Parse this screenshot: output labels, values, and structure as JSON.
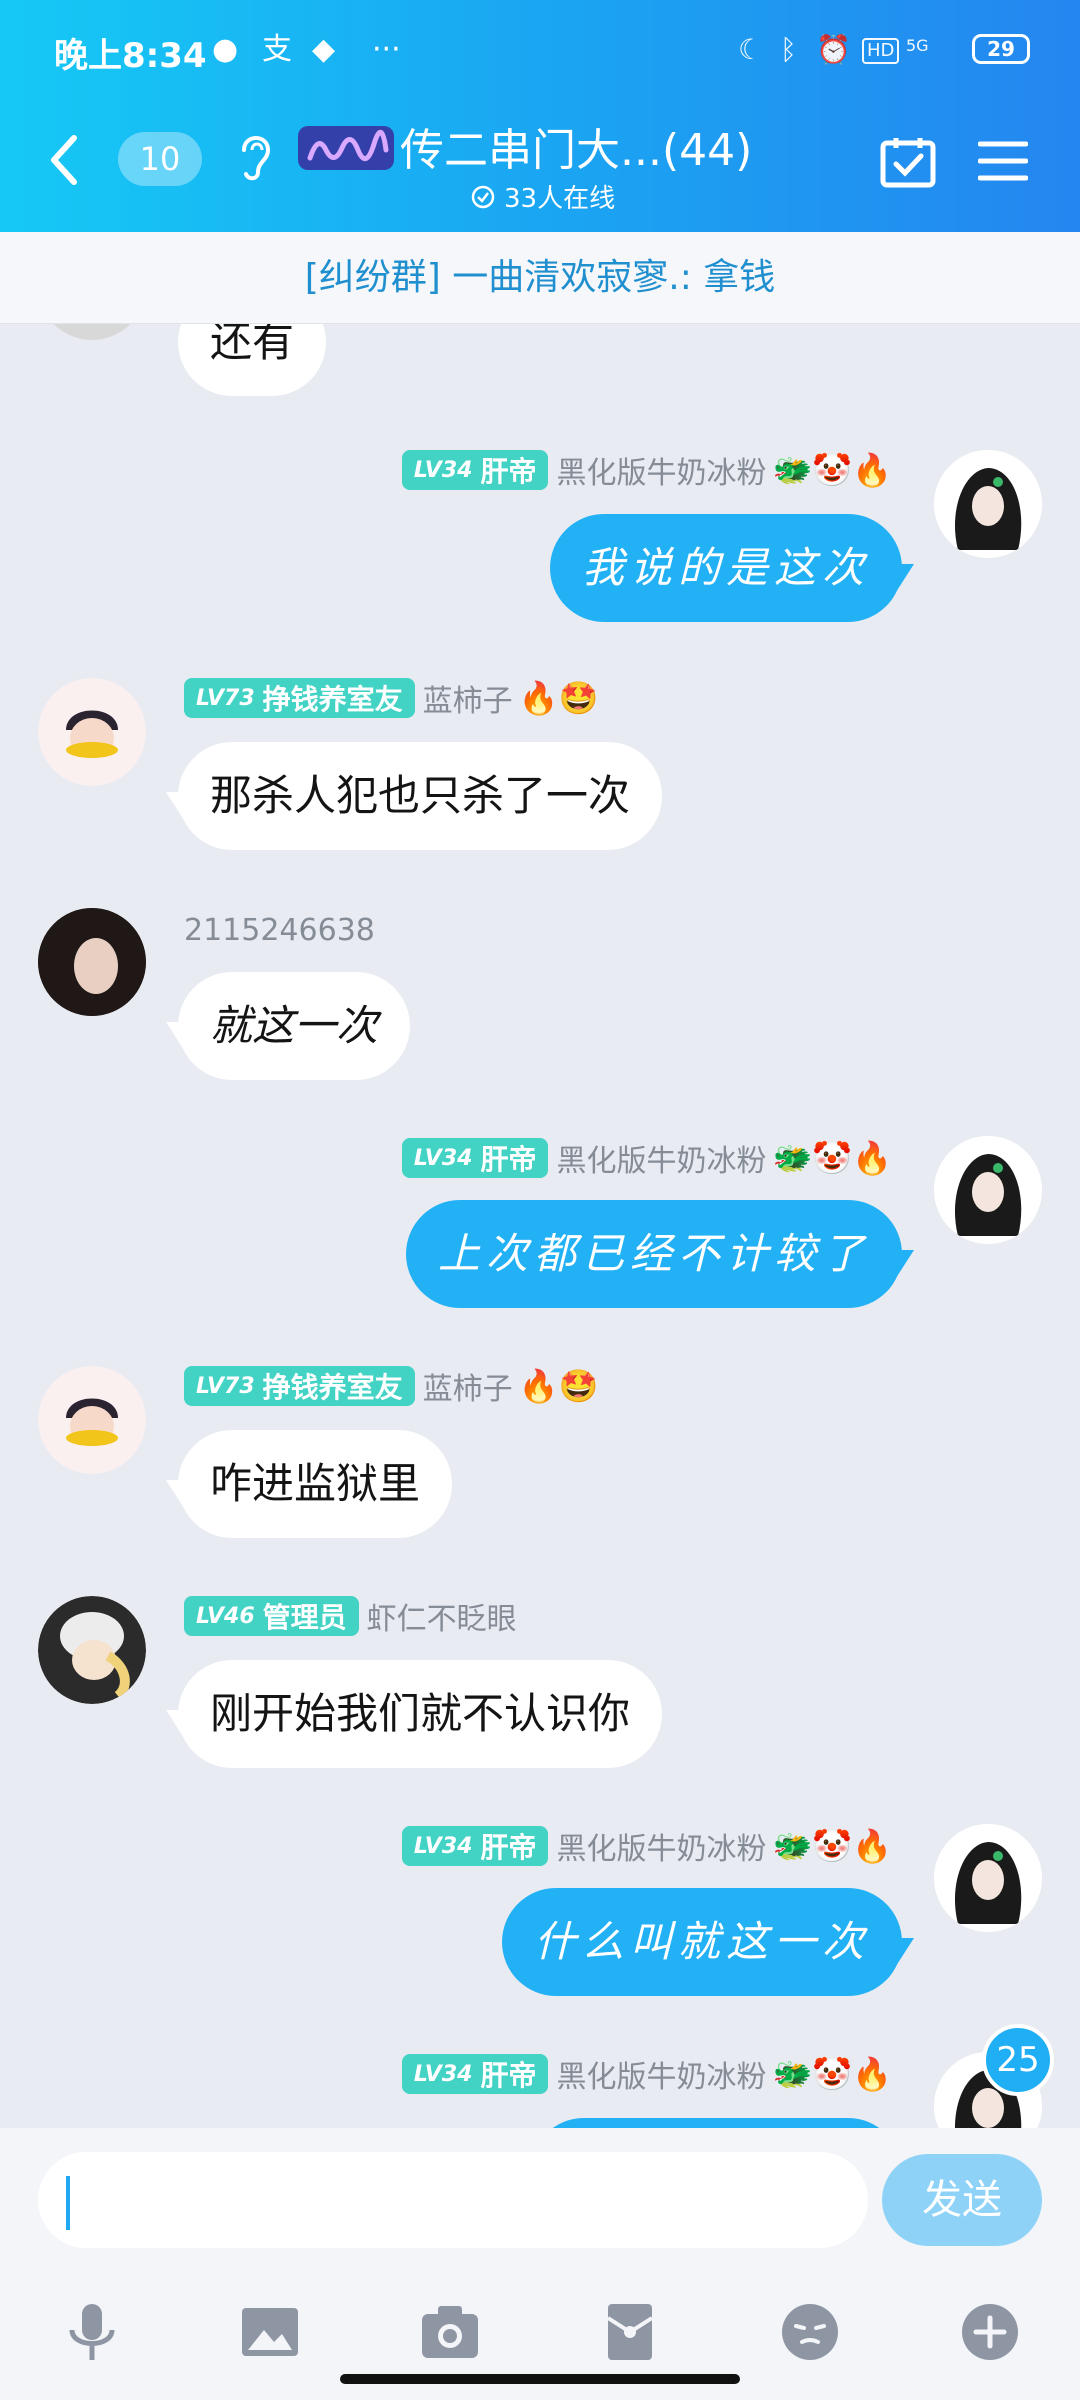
{
  "status_bar": {
    "time": "晚上8:34",
    "icons": [
      "wechat-icon",
      "alipay-icon",
      "app-icon",
      "more-dots-icon"
    ],
    "right_icons": [
      "moon-icon",
      "bluetooth-icon",
      "alarm-icon",
      "hd-icon",
      "signal-5g-icon"
    ],
    "network": "5G",
    "battery": "29"
  },
  "nav": {
    "unread_count": "10",
    "group_name": "传二串门大...(44)",
    "online_count": "33人在线"
  },
  "banner": {
    "text": "[纠纷群] 一曲清欢寂寥.: 拿钱"
  },
  "messages": [
    {
      "side": "in",
      "name": "",
      "text": "还有"
    },
    {
      "side": "out",
      "level": "LV34",
      "title": "肝帝",
      "name": "黑化版牛奶冰粉",
      "emojis": "🐲🤡🔥",
      "text": "我说的是这次"
    },
    {
      "side": "in",
      "level": "LV73",
      "title": "挣钱养室友",
      "name": "蓝柿子",
      "emojis": "🔥🤩",
      "text": "那杀人犯也只杀了一次"
    },
    {
      "side": "in",
      "name": "2115246638",
      "text": "就这一次"
    },
    {
      "side": "out",
      "level": "LV34",
      "title": "肝帝",
      "name": "黑化版牛奶冰粉",
      "emojis": "🐲🤡🔥",
      "text": "上次都已经不计较了"
    },
    {
      "side": "in",
      "level": "LV73",
      "title": "挣钱养室友",
      "name": "蓝柿子",
      "emojis": "🔥🤩",
      "text": "咋进监狱里"
    },
    {
      "side": "in",
      "level": "LV46",
      "title": "管理员",
      "name": "虾仁不眨眼",
      "text": "刚开始我们就不认识你"
    },
    {
      "side": "out",
      "level": "LV34",
      "title": "肝帝",
      "name": "黑化版牛奶冰粉",
      "emojis": "🐲🤡🔥",
      "text": "什么叫就这一次"
    },
    {
      "side": "out",
      "level": "LV34",
      "title": "肝帝",
      "name": "黑化版牛奶冰粉",
      "emojis": "🐲🤡🔥",
      "text": ""
    }
  ],
  "new_message_count": "25",
  "input": {
    "value": "",
    "send_label": "发送"
  },
  "toolbar": [
    "microphone-icon",
    "image-icon",
    "camera-icon",
    "red-packet-icon",
    "emoji-icon",
    "plus-icon"
  ],
  "colors": {
    "header_start": "#16c9f5",
    "header_end": "#2486f0",
    "bubble_out": "#23b1f5",
    "badge": "#43d3c5",
    "banner_text": "#1f8fcf"
  }
}
